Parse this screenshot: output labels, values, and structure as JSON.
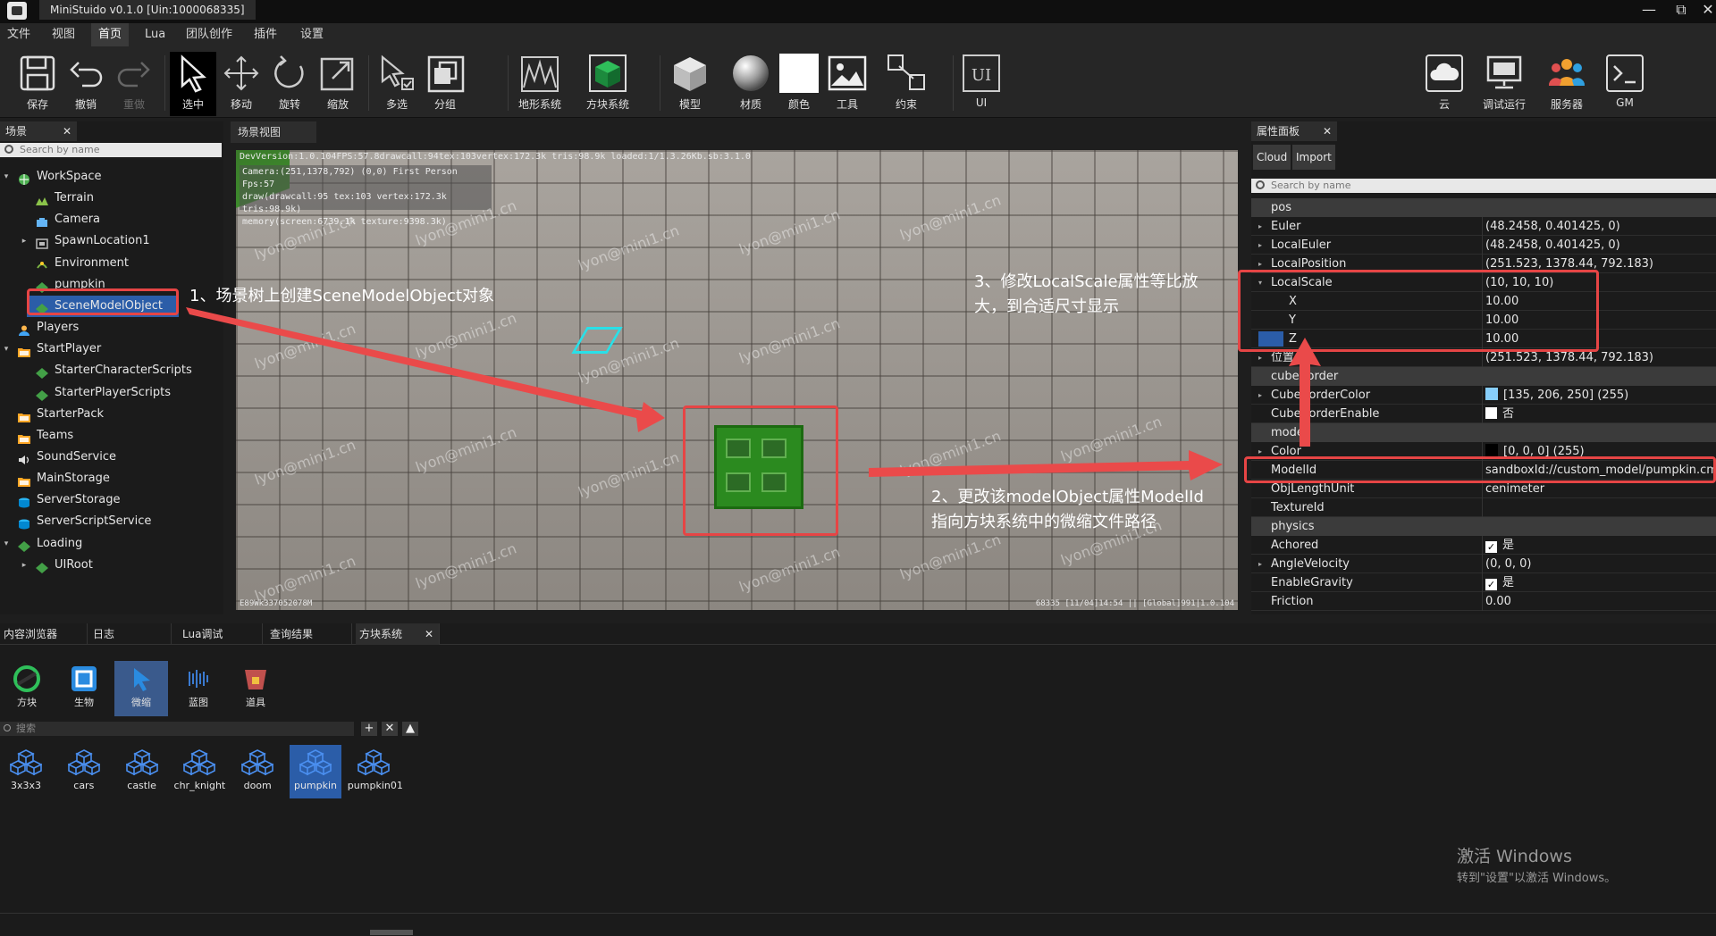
{
  "window": {
    "title": "MiniStuido v0.1.0 [Uin:1000068335]"
  },
  "menu": [
    "文件",
    "视图",
    "首页",
    "Lua",
    "团队创作",
    "插件",
    "设置"
  ],
  "toolbar": {
    "save": "保存",
    "undo": "撤销",
    "redo": "重做",
    "select": "选中",
    "move": "移动",
    "rotate": "旋转",
    "scale": "缩放",
    "multiselect": "多选",
    "group": "分组",
    "terrain": "地形系统",
    "block": "方块系统",
    "model": "模型",
    "material": "材质",
    "color": "颜色",
    "tools": "工具",
    "constraint": "约束",
    "ui": "UI",
    "ui_icon_text": "UI",
    "cloud": "云",
    "debug_run": "调试运行",
    "server": "服务器",
    "gm": "GM"
  },
  "scene": {
    "tab": "场景",
    "search_placeholder": "Search by name",
    "items": [
      {
        "label": "WorkSpace"
      },
      {
        "label": "Terrain"
      },
      {
        "label": "Camera"
      },
      {
        "label": "SpawnLocation1"
      },
      {
        "label": "Environment"
      },
      {
        "label": "pumpkin"
      },
      {
        "label": "SceneModelObject"
      },
      {
        "label": "Players"
      },
      {
        "label": "StartPlayer"
      },
      {
        "label": "StarterCharacterScripts"
      },
      {
        "label": "StarterPlayerScripts"
      },
      {
        "label": "StarterPack"
      },
      {
        "label": "Teams"
      },
      {
        "label": "SoundService"
      },
      {
        "label": "MainStorage"
      },
      {
        "label": "ServerStorage"
      },
      {
        "label": "ServerScriptService"
      },
      {
        "label": "Loading"
      },
      {
        "label": "UIRoot"
      }
    ]
  },
  "viewport": {
    "tab": "场景视图",
    "dev_line": "DevVersion:1.0.104FPS:57.8drawcall:94tex:103vertex:172.3k tris:98.9k loaded:1/1.3.26Kb.sb:3.1.0",
    "camera_line": "Camera:(251,1378,792) (0,0) First Person Fps:57",
    "draw_line": "draw(drawcall:95 tex:103 vertex:172.3k tris:98.9k)",
    "memory_line": "memory(screen:6739.1k texture:9398.3k)",
    "watermark": "lyon@mini1.cn",
    "bottom_left": "E89Wk337052078M",
    "bottom_right": "68335 [11/04]14:54 || [Global]991|1.0.104"
  },
  "annotations": {
    "step1": "1、场景树上创建SceneModelObject对象",
    "step2_line1": "2、更改该modelObject属性ModelId",
    "step2_line2": "指向方块系统中的微缩文件路径",
    "step3_line1": "3、修改LocalScale属性等比放",
    "step3_line2": "大，到合适尺寸显示"
  },
  "properties": {
    "tab": "属性面板",
    "cloud_btn": "Cloud",
    "import_btn": "Import",
    "search_placeholder": "Search by name",
    "cat_pos": "pos",
    "euler": {
      "name": "Euler",
      "value": "(48.2458, 0.401425, 0)"
    },
    "local_euler": {
      "name": "LocalEuler",
      "value": "(48.2458, 0.401425, 0)"
    },
    "local_position": {
      "name": "LocalPosition",
      "value": "(251.523, 1378.44, 792.183)"
    },
    "local_scale": {
      "name": "LocalScale",
      "value": "(10, 10, 10)"
    },
    "scale_x": {
      "name": "X",
      "value": "10.00"
    },
    "scale_y": {
      "name": "Y",
      "value": "10.00"
    },
    "scale_z": {
      "name": "Z",
      "value": "10.00"
    },
    "position": {
      "name": "位置",
      "value": "(251.523, 1378.44, 792.183)"
    },
    "cat_cube": "cubeBorder",
    "cube_border_color": {
      "name": "CubeBorderColor",
      "value": "[135, 206, 250] (255)",
      "swatch": "#87cefa"
    },
    "cube_border_enable": {
      "name": "CubeBorderEnable",
      "value": "否"
    },
    "cat_model": "model",
    "color": {
      "name": "Color",
      "value": "[0, 0, 0] (255)",
      "swatch": "#000000"
    },
    "model_id": {
      "name": "ModelId",
      "value": "sandboxId://custom_model/pumpkin.cm"
    },
    "obj_length_unit": {
      "name": "ObjLengthUnit",
      "value": "cenimeter"
    },
    "texture_id": {
      "name": "TextureId",
      "value": ""
    },
    "cat_physics": "physics",
    "achored": {
      "name": "Achored",
      "value": "是"
    },
    "angle_velocity": {
      "name": "AngleVelocity",
      "value": "(0, 0, 0)"
    },
    "enable_gravity": {
      "name": "EnableGravity",
      "value": "是"
    },
    "friction": {
      "name": "Friction",
      "value": "0.00"
    }
  },
  "bottom": {
    "tabs": [
      "内容浏览器",
      "日志",
      "Lua调试",
      "查询结果",
      "方块系统"
    ],
    "categories": [
      "方块",
      "生物",
      "微缩",
      "蓝图",
      "道具"
    ],
    "search_placeholder": "搜索",
    "assets": [
      "3x3x3",
      "cars",
      "castle",
      "chr_knight",
      "doom",
      "pumpkin",
      "pumpkin01"
    ]
  },
  "activation": {
    "line1": "激活 Windows",
    "line2": "转到\"设置\"以激活 Windows。"
  },
  "colors": {
    "accent": "#2b5da8",
    "annotation_red": "#e64545"
  }
}
